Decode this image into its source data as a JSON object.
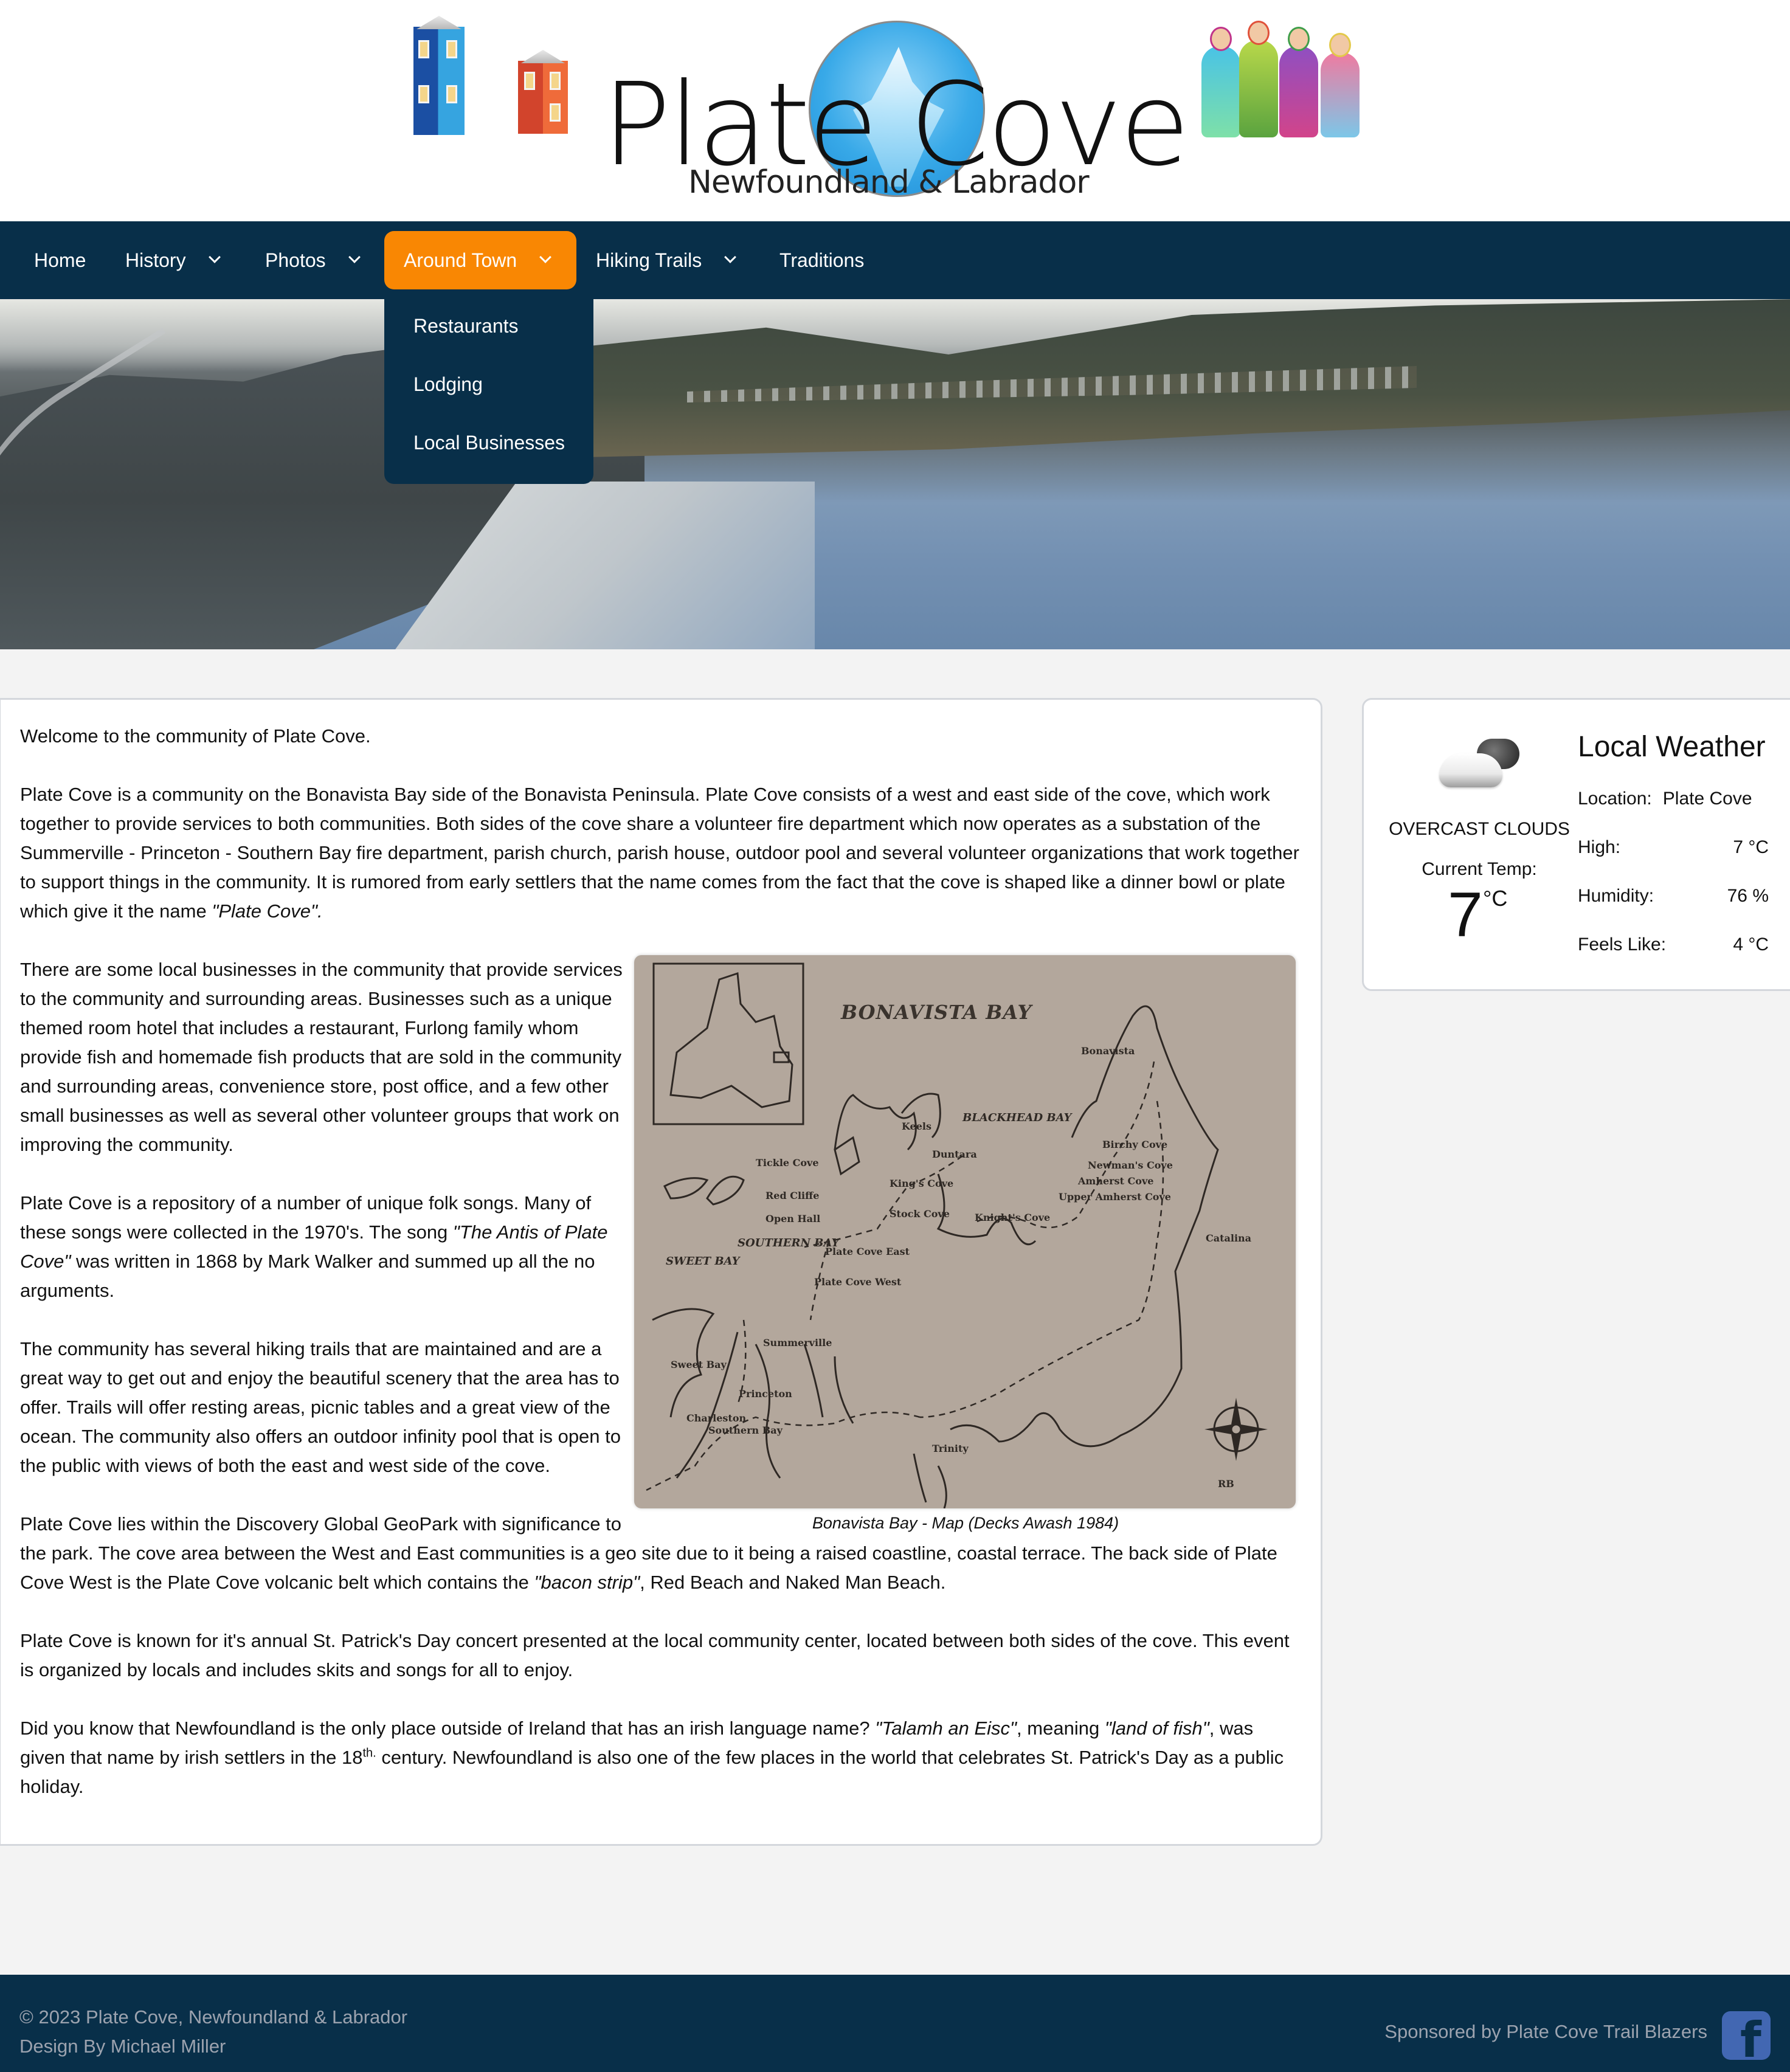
{
  "header": {
    "logo_title": "Plate Cove",
    "logo_subtitle": "Newfoundland & Labrador"
  },
  "nav": {
    "items": [
      {
        "label": "Home",
        "has_dropdown": false
      },
      {
        "label": "History",
        "has_dropdown": true
      },
      {
        "label": "Photos",
        "has_dropdown": true
      },
      {
        "label": "Around Town",
        "has_dropdown": true,
        "active": true
      },
      {
        "label": "Hiking Trails",
        "has_dropdown": true
      },
      {
        "label": "Traditions",
        "has_dropdown": false
      }
    ],
    "dropdown": {
      "parent": "Around Town",
      "items": [
        "Restaurants",
        "Lodging",
        "Local Businesses"
      ]
    },
    "active_color": "#f98703",
    "bar_color": "#082f49"
  },
  "content": {
    "welcome": "Welcome to the community of Plate Cove.",
    "p1": "Plate Cove is a community on the Bonavista Bay side of the Bonavista Peninsula. Plate Cove consists of a west and east side of the cove, which work together to provide services to both communities. Both sides of the cove share a volunteer fire department which now operates as a substation of the Summerville - Princeton - Southern Bay fire department, parish church, parish house, outdoor pool and several volunteer organizations that work together to support things in the community. It is rumored from early settlers that the name comes from the fact that the cove is shaped like a dinner bowl or plate which give it the name ",
    "p1_em": "\"Plate Cove\".",
    "p2": "There are some local businesses in the community that provide services to the community and surrounding areas. Businesses such as a unique themed room hotel that includes a restaurant, Furlong family whom provide fish and homemade fish products that are sold in the community and surrounding areas, convenience store, post office, and a few other small businesses as well as several other volunteer groups that work on improving the community.",
    "p3_a": "Plate Cove is a repository of a number of unique folk songs. Many of these songs were collected in the 1970's. The song ",
    "p3_em": "\"The Antis of Plate Cove\"",
    "p3_b": " was written in 1868 by Mark Walker and summed up all the no arguments.",
    "p4": "The community has several hiking trails that are maintained and are a great way to get out and enjoy the beautiful scenery that the area has to offer. Trails will offer resting areas, picnic tables and a great view of the ocean. The community also offers an outdoor infinity pool that is open to the public with views of both the east and west side of the cove.",
    "p5_a": "Plate Cove lies within the Discovery Global GeoPark with significance to the park. The cove area between the West and East communities is a geo site due to it being a raised coastline, coastal terrace. The back side of Plate Cove West is the Plate Cove volcanic belt which contains the ",
    "p5_em": "\"bacon strip\"",
    "p5_b": ", Red Beach and Naked Man Beach.",
    "p6": "Plate Cove is known for it's annual St. Patrick's Day concert presented at the local community center, located between both sides of the cove. This event is organized by locals and includes skits and songs for all to enjoy.",
    "p7_a": "Did you know that Newfoundland is the only place outside of Ireland that has an irish language name? ",
    "p7_em1": "\"Talamh an Eisc\"",
    "p7_b": ",  meaning ",
    "p7_em2": "\"land of fish\"",
    "p7_c": ",  was given that name by irish settlers in the 18",
    "p7_sup": "th.",
    "p7_d": " century. Newfoundland is also one of the few places in the world that celebrates St. Patrick's Day as a public holiday.",
    "map": {
      "title": "BONAVISTA BAY",
      "caption": "Bonavista Bay - Map (Decks Awash 1984)",
      "region_labels": [
        "BLACKHEAD BAY",
        "SOUTHERN BAY",
        "SWEET BAY"
      ],
      "places": [
        "Bonavista",
        "Keels",
        "Duntara",
        "Tickle Cove",
        "Red Cliffe",
        "Open Hall",
        "King's Cove",
        "Stock Cove",
        "Knight's Cove",
        "Birchy Cove",
        "Newman's Cove",
        "Amherst Cove",
        "Upper Amherst Cove",
        "Catalina",
        "Plate Cove East",
        "Plate Cove West",
        "Summerville",
        "Sweet Bay",
        "Princeton",
        "Charleston",
        "Southern Bay",
        "Trinity"
      ],
      "signature": "RB"
    }
  },
  "weather": {
    "title": "Local Weather",
    "condition": "OVERCAST CLOUDS",
    "current_label": "Current Temp:",
    "current_value": "7",
    "current_unit": "°C",
    "location_label": "Location:",
    "location_value": "Plate Cove",
    "high_label": "High:",
    "high_value": "7 °C",
    "humidity_label": "Humidity:",
    "humidity_value": "76 %",
    "feels_label": "Feels Like:",
    "feels_value": "4 °C",
    "icon": "overcast-clouds-icon"
  },
  "footer": {
    "copyright": "© 2023 Plate Cove, Newfoundland & Labrador",
    "design": "Design By Michael Miller",
    "sponsor": "Sponsored by Plate Cove Trail Blazers",
    "social_icon": "facebook-icon",
    "social_glyph": "f",
    "social_color": "#4267b2"
  }
}
